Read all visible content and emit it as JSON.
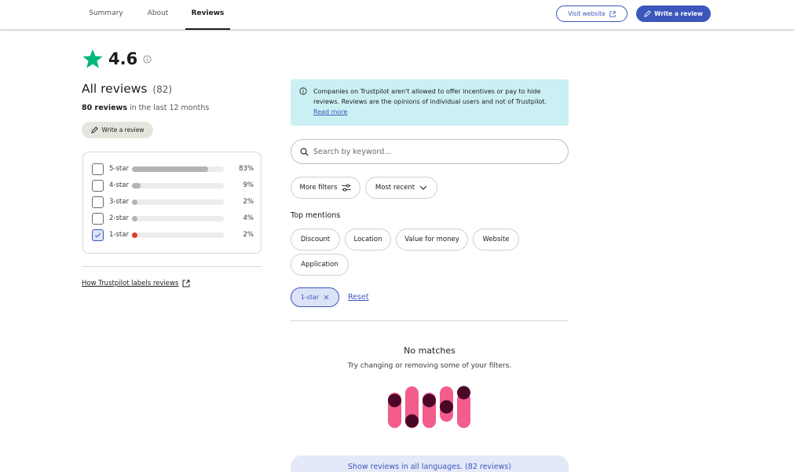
{
  "nav": {
    "tabs": [
      {
        "label": "Summary"
      },
      {
        "label": "About"
      },
      {
        "label": "Reviews",
        "active": true
      }
    ],
    "visit_website": "Visit website",
    "write_review": "Write a review"
  },
  "summary": {
    "score": "4.6",
    "all_reviews_label": "All reviews",
    "all_reviews_count": "(82)",
    "recent_count": "80 reviews",
    "recent_suffix": " in the last 12 months",
    "write_review_small": "Write a review"
  },
  "distribution": [
    {
      "label": "5-star",
      "percent": "83%",
      "fraction": 0.83,
      "checked": false,
      "color": "#b3b3b3"
    },
    {
      "label": "4-star",
      "percent": "9%",
      "fraction": 0.09,
      "checked": false,
      "color": "#b3b3b3"
    },
    {
      "label": "3-star",
      "percent": "2%",
      "fraction": 0.02,
      "checked": false,
      "color": "#b3b3b3"
    },
    {
      "label": "2-star",
      "percent": "4%",
      "fraction": 0.04,
      "checked": false,
      "color": "#b3b3b3"
    },
    {
      "label": "1-star",
      "percent": "2%",
      "fraction": 0.02,
      "checked": true,
      "color": "#e03b2b"
    }
  ],
  "how_labels_link": "How Trustpilot labels reviews",
  "notice": {
    "text": "Companies on Trustpilot aren't allowed to offer incentives or pay to hide reviews. Reviews are the opinions of individual users and not of Trustpilot.",
    "link": "Read more"
  },
  "search": {
    "placeholder": "Search by keyword..."
  },
  "filters": {
    "more_filters": "More filters",
    "sort": "Most recent"
  },
  "top_mentions": {
    "title": "Top mentions",
    "items": [
      "Discount",
      "Location",
      "Value for money",
      "Website",
      "Application"
    ]
  },
  "active_filter": {
    "label": "1-star",
    "reset": "Reset"
  },
  "empty_state": {
    "title": "No matches",
    "text": "Try changing or removing some of your filters."
  },
  "show_all_languages": "Show reviews in all languages. (82 reviews)",
  "colors": {
    "accent": "#3c57bc",
    "star_green": "#00b67a",
    "notice_bg": "#cbf0f4",
    "illus_pink": "#f25d8c",
    "illus_dark": "#4a0727"
  }
}
